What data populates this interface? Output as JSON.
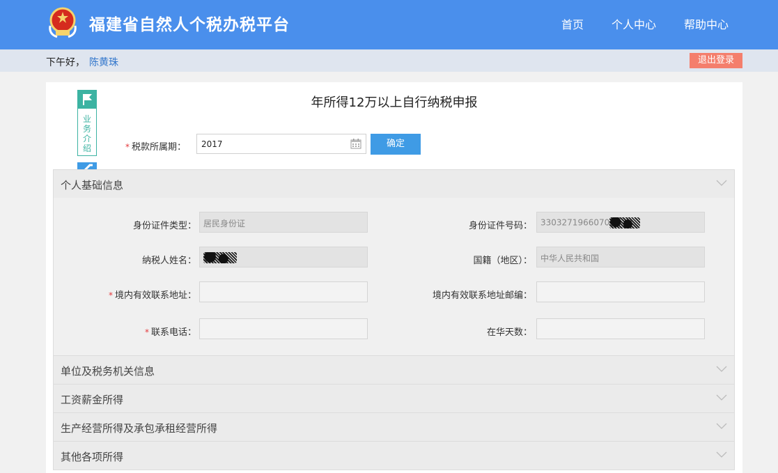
{
  "header": {
    "site_title": "福建省自然人个税办税平台",
    "nav": [
      {
        "label": "首页"
      },
      {
        "label": "个人中心"
      },
      {
        "label": "帮助中心"
      }
    ]
  },
  "greeting": {
    "text": "下午好，",
    "user_name": "陈黄珠",
    "logout_label": "退出登录"
  },
  "side_tab": {
    "label": "业务介绍"
  },
  "page": {
    "title": "年所得12万以上自行纳税申报",
    "required_mark": "*",
    "period_label": "税款所属期：",
    "period_value": "2017",
    "confirm_label": "确定"
  },
  "sections": [
    {
      "label": "个人基础信息"
    },
    {
      "label": "单位及税务机关信息"
    },
    {
      "label": "工资薪金所得"
    },
    {
      "label": "生产经营所得及承包承租经营所得"
    },
    {
      "label": "其他各项所得"
    }
  ],
  "basic_info": {
    "id_type_label": "身份证件类型：",
    "id_type_value": "居民身份证",
    "id_number_label": "身份证件号码：",
    "id_number_value": "3303271966070",
    "name_label": "纳税人姓名：",
    "nationality_label": "国籍（地区）：",
    "nationality_value": "中华人民共和国",
    "address_label": "境内有效联系地址：",
    "postcode_label": "境内有效联系地址邮编：",
    "phone_label": "联系电话：",
    "days_label": "在华天数："
  },
  "colors": {
    "header_bg": "#4a8fec",
    "accent_teal": "#3cb3a2",
    "button_blue": "#3f9be5",
    "logout_red": "#f47e6c"
  }
}
